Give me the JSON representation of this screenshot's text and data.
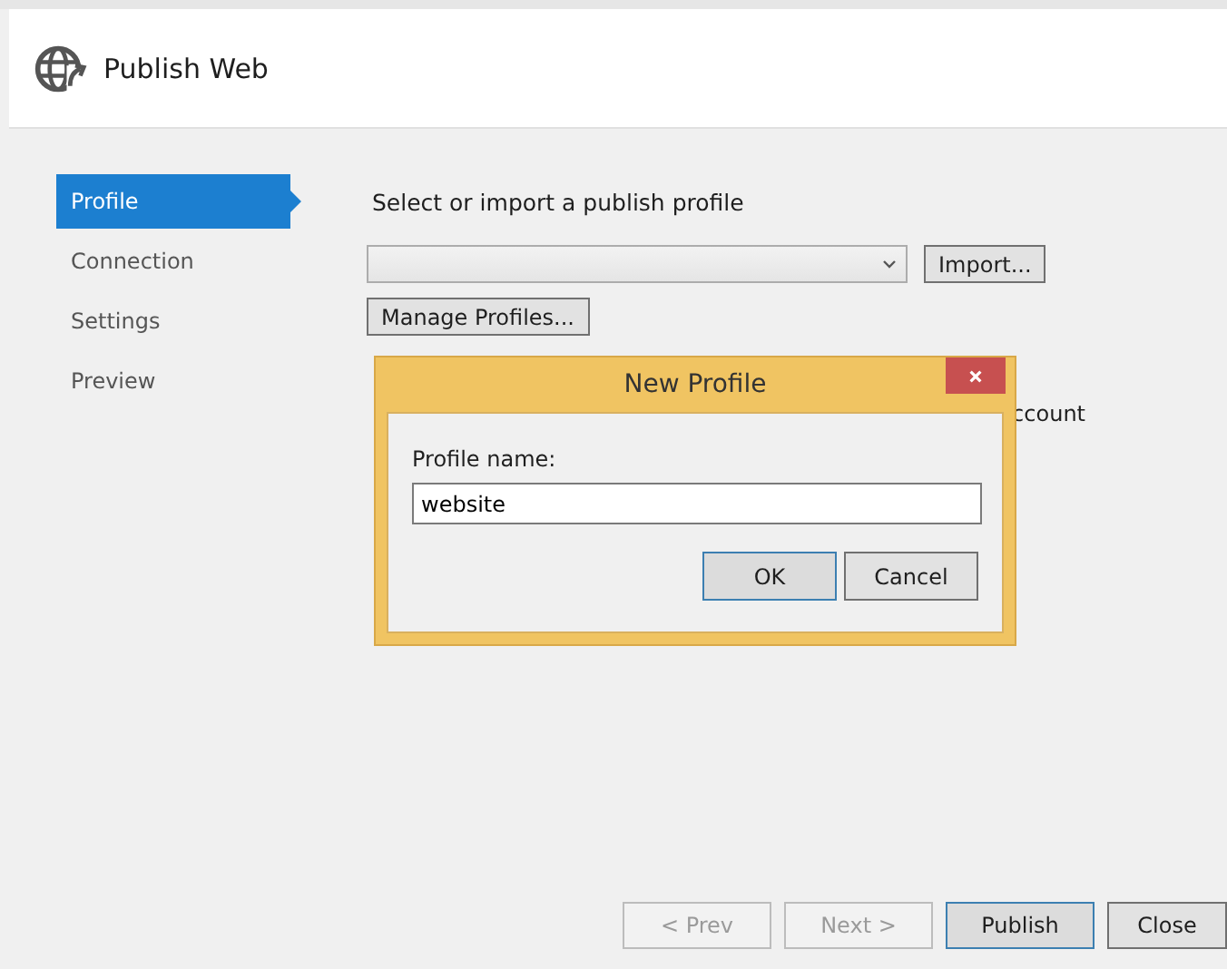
{
  "header": {
    "title": "Publish Web"
  },
  "sidebar": {
    "items": [
      {
        "label": "Profile",
        "selected": true
      },
      {
        "label": "Connection",
        "selected": false
      },
      {
        "label": "Settings",
        "selected": false
      },
      {
        "label": "Preview",
        "selected": false
      }
    ]
  },
  "content": {
    "heading": "Select or import a publish profile",
    "import_button": "Import...",
    "manage_button": "Manage Profiles...",
    "covered_text": "ccount"
  },
  "dialog": {
    "title": "New Profile",
    "label": "Profile name:",
    "value": "website",
    "buttons": [
      {
        "label": "OK",
        "focused": true
      },
      {
        "label": "Cancel",
        "focused": false
      }
    ]
  },
  "footer_buttons": [
    {
      "label": "< Prev",
      "disabled": true,
      "focused": false
    },
    {
      "label": "Next >",
      "disabled": true,
      "focused": false
    },
    {
      "label": "Publish",
      "disabled": false,
      "focused": true
    },
    {
      "label": "Close",
      "disabled": false,
      "focused": false
    }
  ]
}
